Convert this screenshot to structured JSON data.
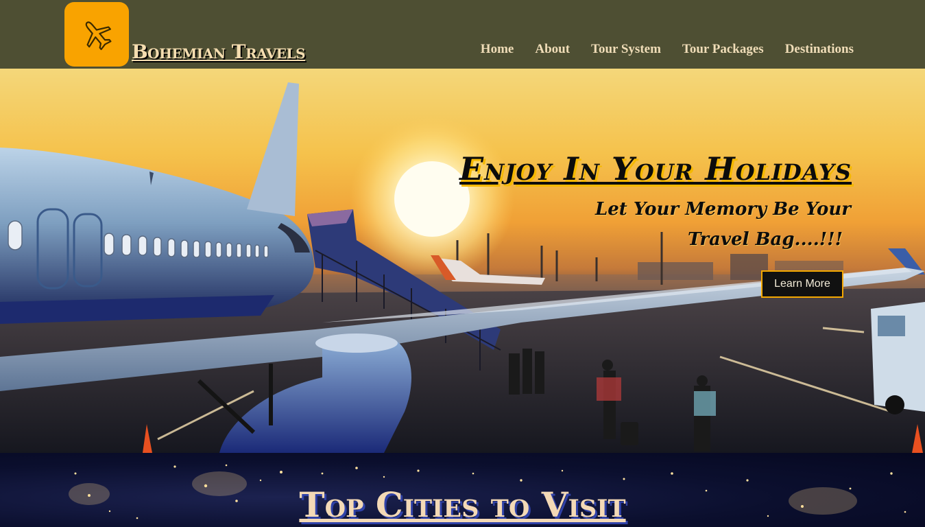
{
  "brand": {
    "name": "Bohemian Travels",
    "logo_icon": "airplane-icon",
    "logo_color": "#f9a300"
  },
  "nav": {
    "items": [
      {
        "label": "Home"
      },
      {
        "label": "About"
      },
      {
        "label": "Tour System"
      },
      {
        "label": "Tour Packages"
      },
      {
        "label": "Destinations"
      }
    ]
  },
  "hero": {
    "title": "Enjoy In Your Holidays",
    "subtitle_line1": "Let Your Memory Be Your",
    "subtitle_line2": "Travel Bag....!!!",
    "button_label": "Learn More",
    "accent_color": "#f5a800"
  },
  "cities": {
    "title": "Top Cities to Visit"
  }
}
